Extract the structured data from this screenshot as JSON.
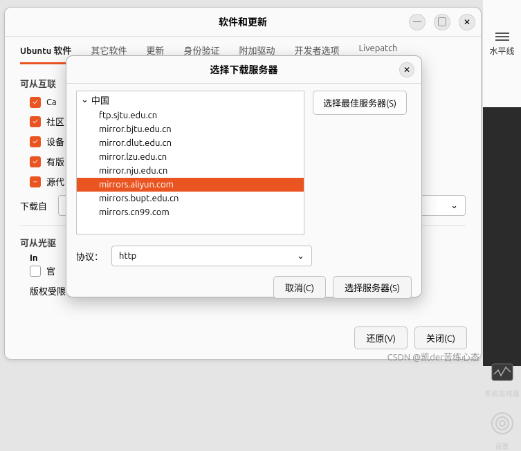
{
  "right_sidebar": {
    "top_label": "水平线",
    "monitor_label": "系统监视器",
    "settings_label": "设置"
  },
  "main": {
    "title": "软件和更新",
    "tabs": [
      "Ubuntu 软件",
      "其它软件",
      "更新",
      "身份验证",
      "附加驱动",
      "开发者选项",
      "Livepatch"
    ],
    "section_internet": "可从互联",
    "checks": [
      "Ca",
      "社区",
      "设备",
      "有版",
      "源代"
    ],
    "download_label": "下载自",
    "section_optical": "可从光驱",
    "install_label": "In",
    "official_label": "官",
    "copyright_label": "版权受限",
    "btn_revert": "还原(V)",
    "btn_close": "关闭(C)"
  },
  "modal": {
    "title": "选择下载服务器",
    "tree_parent": "中国",
    "servers": [
      "ftp.sjtu.edu.cn",
      "mirror.bjtu.edu.cn",
      "mirror.dlut.edu.cn",
      "mirror.lzu.edu.cn",
      "mirror.nju.edu.cn",
      "mirrors.aliyun.com",
      "mirrors.bupt.edu.cn",
      "mirrors.cn99.com"
    ],
    "selected_index": 5,
    "btn_best": "选择最佳服务器(S)",
    "protocol_label": "协议：",
    "protocol_value": "http",
    "btn_cancel": "取消(C)",
    "btn_choose": "选择服务器(S)"
  },
  "watermark": "CSDN @凯der苦练心态"
}
